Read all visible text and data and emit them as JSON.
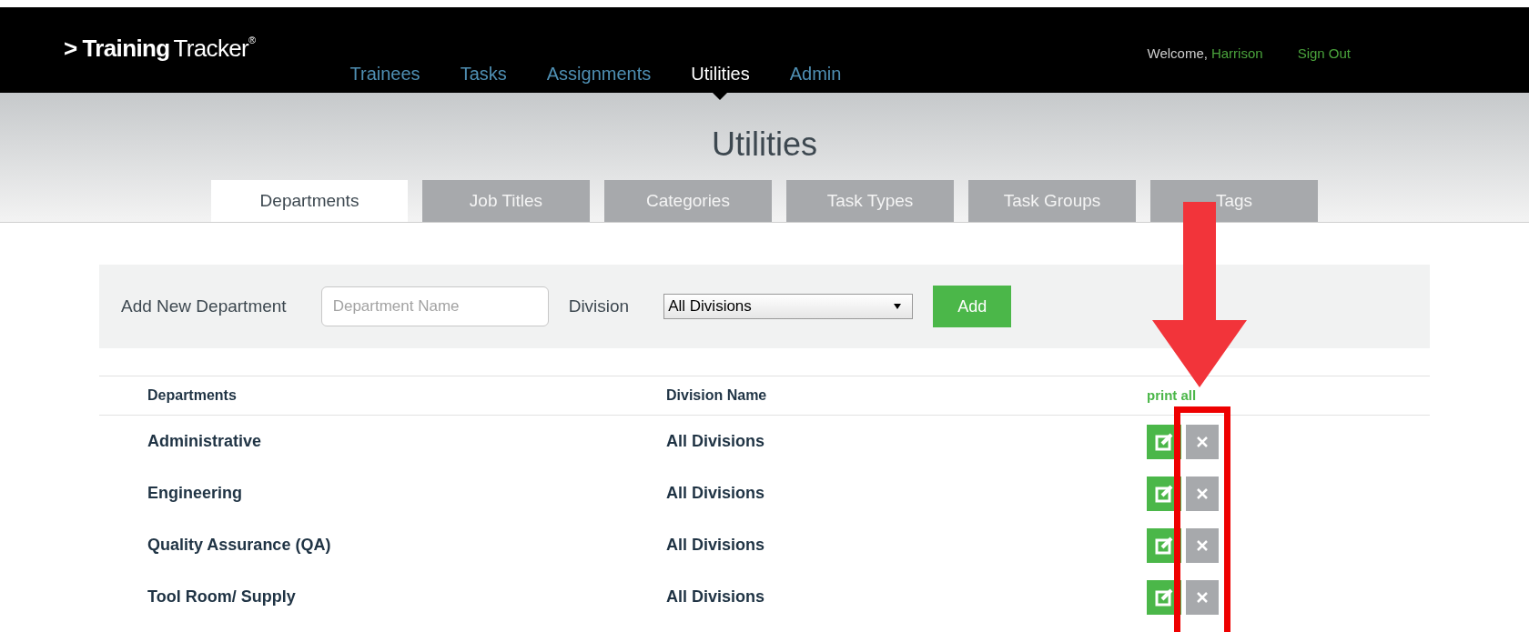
{
  "logo": {
    "mark": ">",
    "word_bold": "Training",
    "word_light": "Tracker",
    "registered": "®"
  },
  "nav": [
    {
      "label": "Trainees",
      "selected": false
    },
    {
      "label": "Tasks",
      "selected": false
    },
    {
      "label": "Assignments",
      "selected": false
    },
    {
      "label": "Utilities",
      "selected": true
    },
    {
      "label": "Admin",
      "selected": false
    }
  ],
  "user": {
    "greeting": "Welcome,",
    "name": "Harrison",
    "sign_out": "Sign Out"
  },
  "page_title": "Utilities",
  "tabs": [
    {
      "label": "Departments",
      "selected": true
    },
    {
      "label": "Job Titles",
      "selected": false
    },
    {
      "label": "Categories",
      "selected": false
    },
    {
      "label": "Task Types",
      "selected": false
    },
    {
      "label": "Task Groups",
      "selected": false
    },
    {
      "label": "Tags",
      "selected": false
    }
  ],
  "add_form": {
    "label": "Add New Department",
    "name_placeholder": "Department Name",
    "division_label": "Division",
    "division_value": "All Divisions",
    "button": "Add"
  },
  "table": {
    "columns": [
      "Departments",
      "Division Name"
    ],
    "print_all": "print all",
    "rows": [
      {
        "department": "Administrative",
        "division": "All Divisions"
      },
      {
        "department": "Engineering",
        "division": "All Divisions"
      },
      {
        "department": "Quality Assurance (QA)",
        "division": "All Divisions"
      },
      {
        "department": "Tool Room/ Supply",
        "division": "All Divisions"
      }
    ]
  }
}
